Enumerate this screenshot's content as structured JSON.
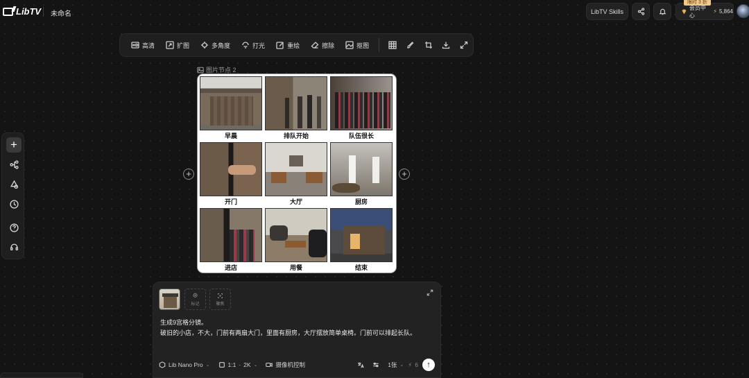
{
  "app": {
    "brand": "LibTV",
    "doc_title": "未命名"
  },
  "header": {
    "skills_label": "LibTV Skills",
    "promo_badge": "限时 3 折",
    "member_label": "会员中心",
    "credits": "5,864"
  },
  "toolbar": {
    "tools": [
      "高清",
      "扩图",
      "多角度",
      "打光",
      "重绘",
      "擦除",
      "抠图"
    ]
  },
  "node": {
    "label": "图片节点 2",
    "cells": [
      {
        "caption": "早晨"
      },
      {
        "caption": "排队开始"
      },
      {
        "caption": "队伍很长"
      },
      {
        "caption": "开门"
      },
      {
        "caption": "大厅"
      },
      {
        "caption": "厨房"
      },
      {
        "caption": "进店"
      },
      {
        "caption": "用餐"
      },
      {
        "caption": "结束"
      }
    ]
  },
  "prompt": {
    "ref_mark_label": "标记",
    "ref_focus_label": "聚焦",
    "line1": "生成9宫格分镜。",
    "line2": "破旧的小店，不大，门前有两扇大门，里面有厨房，大厅摆放简单桌椅。门前可以排起长队。",
    "model": "Lib Nano Pro",
    "ratio": "1:1",
    "resolution": "2K",
    "camera_label": "摄像机控制",
    "count": "1张",
    "cost": "6"
  },
  "colors": {
    "background": "#141414",
    "panel": "#222222",
    "promo": "#f3c98b",
    "gold": "#e6b450"
  }
}
